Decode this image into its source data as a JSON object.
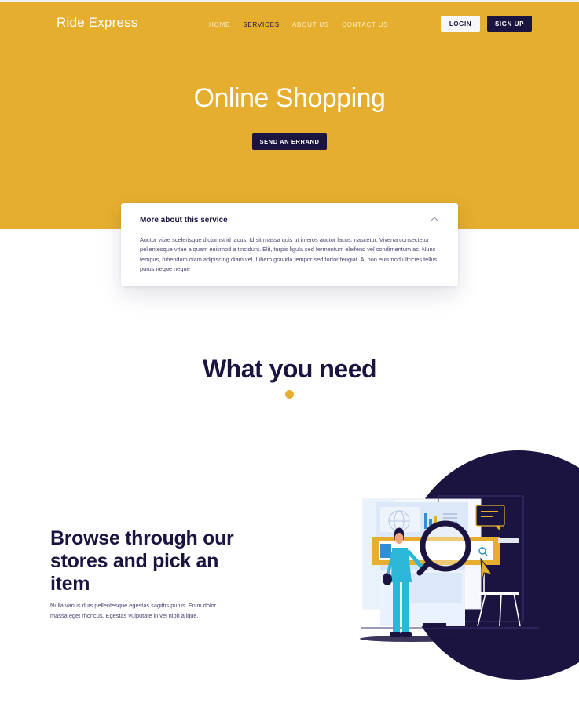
{
  "brand": {
    "logo": "Ride Express"
  },
  "nav": {
    "items": [
      {
        "label": "HOME"
      },
      {
        "label": "SERVICES"
      },
      {
        "label": "ABOUT US"
      },
      {
        "label": "CONTACT US"
      }
    ],
    "active": "SERVICES"
  },
  "auth": {
    "login_label": "LOGIN",
    "signup_label": "SIGN UP"
  },
  "hero": {
    "title": "Online Shopping",
    "cta_label": "SEND AN ERRAND"
  },
  "service_card": {
    "title": "More about this service",
    "body": "Auctor vitae scelerisque dictumst id lacus. Id sit massa quis ut in eros auctor lacus, nascetur. Viverra consectetur pellentesque vitae a quam euismod a tincidunt. Elit, turpis ligula sed fermentum eleifend vel condimentum ac. Nunc tempus, bibendum diam adipiscing diam vel. Libero gravida tempor sed tortor feugiat. A, non euismod ultricies tellus purus neque neque",
    "expanded": true
  },
  "section": {
    "title": "What you need"
  },
  "feature": {
    "title": "Browse through our stores and pick an item",
    "text": "Nulla varius duis pellentesque egestas sagittis purus. Enim dolor massa eget rhoncus. Egestas vulputate in vel nibh alique."
  },
  "colors": {
    "accent": "#e5ae2f",
    "navy": "#1b1340",
    "white": "#ffffff"
  }
}
